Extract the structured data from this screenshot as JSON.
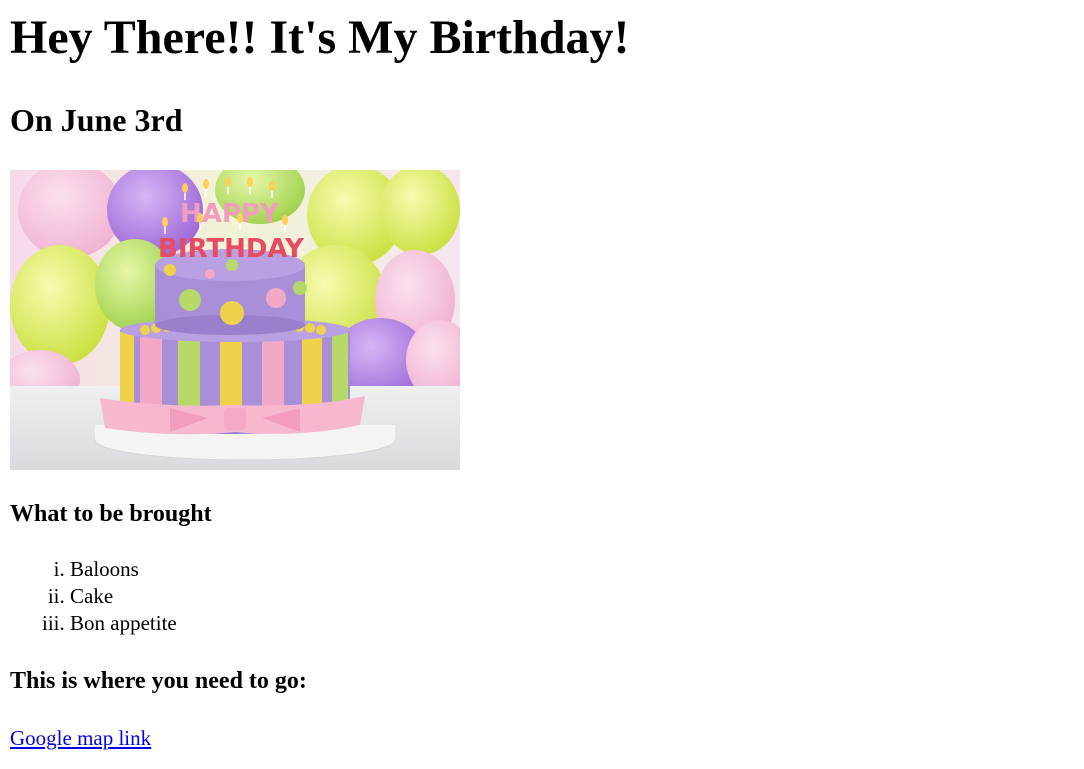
{
  "page": {
    "title": "Hey There!! It's My Birthday!",
    "subtitle": "On June 3rd"
  },
  "image": {
    "description_icon": "birthday-cake-image",
    "topper_line1": "HAPPY",
    "topper_line2": "BIRTHDAY",
    "colors": {
      "cake_purple": "#a98fd8",
      "stripe_yellow": "#f0d24a",
      "stripe_green": "#b7d96a",
      "stripe_pink": "#f3a9c6",
      "ribbon_pink": "#f7b8cf",
      "balloon_yellow": "#e8f26a",
      "balloon_purple": "#b07ee0"
    }
  },
  "bring": {
    "heading": "What to be brought",
    "items": [
      "Baloons",
      "Cake",
      "Bon appetite"
    ]
  },
  "directions": {
    "heading": "This is where you need to go:",
    "link_label": "Google map link",
    "link_color": "#0000ee"
  }
}
